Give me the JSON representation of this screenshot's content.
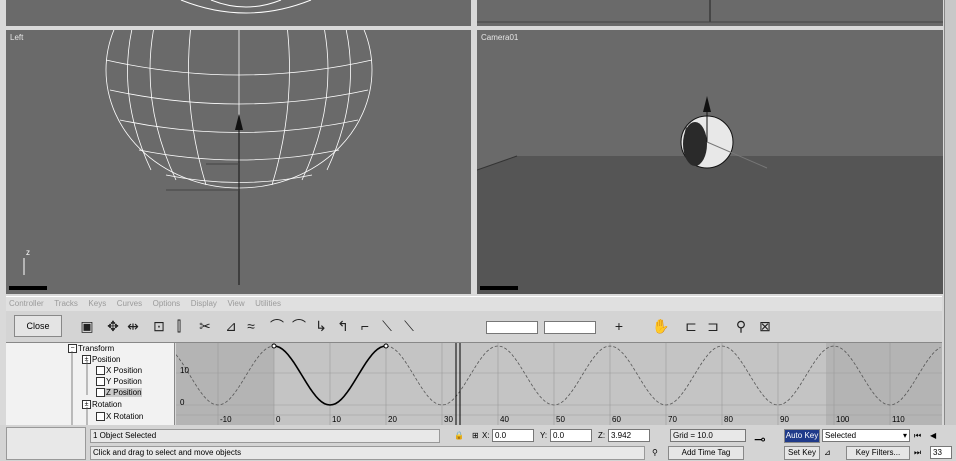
{
  "viewports": {
    "left_label": "Left",
    "camera_label": "Camera01",
    "axis_z": "z"
  },
  "menu": [
    "Controller",
    "Tracks",
    "Keys",
    "Curves",
    "Options",
    "Display",
    "View",
    "Utilities"
  ],
  "toolbar": {
    "close_label": "Close",
    "icons": [
      "track-view-icon",
      "move-keys-icon",
      "slide-keys-icon",
      "scale-keys-icon",
      "scale-values-icon",
      "add-keys-icon",
      "draw-curves-icon",
      "reduce-keys-icon",
      "tangent-auto-icon",
      "tangent-custom-icon",
      "tangent-fast-icon",
      "tangent-slow-icon",
      "tangent-step-icon",
      "tangent-linear-icon",
      "tangent-smooth-icon",
      "lock-selection-icon",
      "pan-icon",
      "zoom-horizontal-icon",
      "zoom-icon",
      "zoom-region-icon"
    ],
    "lock_tangents_label": "+",
    "frame_field": "",
    "value_field": ""
  },
  "tree": {
    "transform": "Transform",
    "position": "Position",
    "x_position": "X Position",
    "y_position": "Y Position",
    "z_position": "Z Position",
    "rotation": "Rotation",
    "x_rotation": "X Rotation"
  },
  "graph": {
    "y_labels": [
      "10",
      "0"
    ],
    "x_labels": [
      "-10",
      "0",
      "10",
      "20",
      "30",
      "40",
      "50",
      "60",
      "70",
      "80",
      "90",
      "100",
      "110"
    ],
    "curve_color": "#000000",
    "out_of_range_color": "#b4b4b4"
  },
  "status": {
    "selection": "1 Object Selected",
    "prompt": "Click and drag to select and move objects",
    "x_label": "X:",
    "x_value": "0.0",
    "y_label": "Y:",
    "y_value": "0.0",
    "z_label": "Z:",
    "z_value": "3.942",
    "grid": "Grid = 10.0",
    "add_time_tag": "Add Time Tag",
    "auto_key": "Auto Key",
    "auto_key_color": "#1f3a8a",
    "selected_option": "Selected",
    "set_key": "Set Key",
    "key_filters": "Key Filters...",
    "current_frame": "33"
  }
}
